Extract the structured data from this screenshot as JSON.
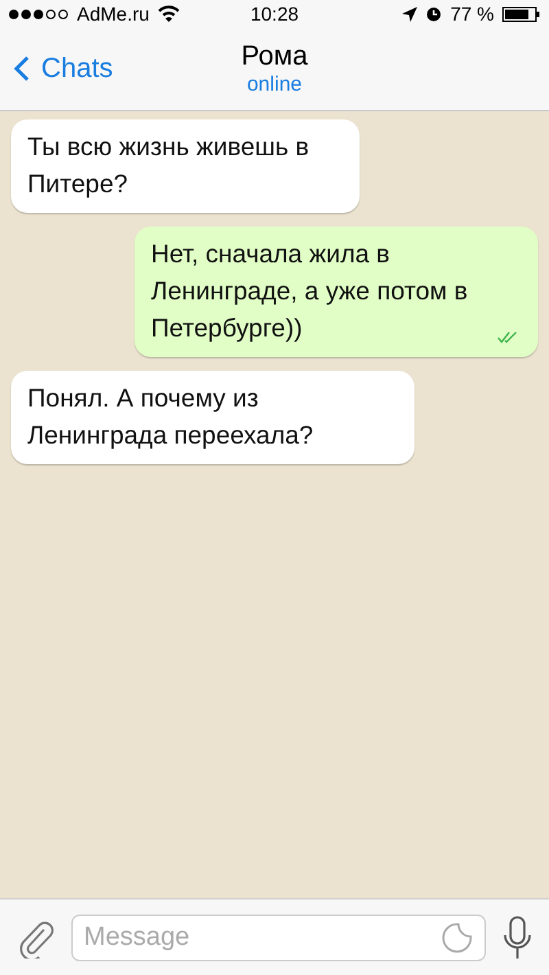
{
  "status_bar": {
    "carrier": "AdMe.ru",
    "time": "10:28",
    "battery": "77 %"
  },
  "header": {
    "back": "Chats",
    "title": "Рома",
    "subtitle": "online"
  },
  "messages": [
    {
      "kind": "incoming",
      "text": "Ты всю жизнь живешь в Питере?"
    },
    {
      "kind": "outgoing",
      "text": "Нет, сначала жила в Ленинграде, а уже потом в Петербурге))",
      "read": true
    },
    {
      "kind": "incoming",
      "text": "Понял. А почему из Ленинграда переехала?"
    }
  ],
  "composer": {
    "placeholder": "Message"
  }
}
